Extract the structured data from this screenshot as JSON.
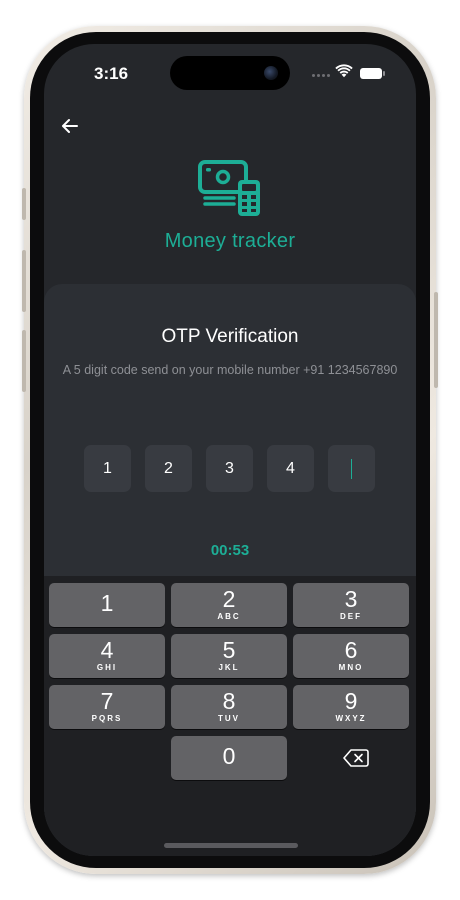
{
  "status_bar": {
    "time": "3:16"
  },
  "header": {
    "back_icon": "arrow-left-icon",
    "logo_icon": "money-calculator-icon",
    "app_name": "Money tracker"
  },
  "otp": {
    "title": "OTP Verification",
    "subtitle": "A 5 digit code send on your mobile number +91 1234567890",
    "digits": [
      "1",
      "2",
      "3",
      "4",
      ""
    ],
    "timer": "00:53"
  },
  "keypad": {
    "keys": [
      {
        "digit": "1",
        "letters": ""
      },
      {
        "digit": "2",
        "letters": "ABC"
      },
      {
        "digit": "3",
        "letters": "DEF"
      },
      {
        "digit": "4",
        "letters": "GHI"
      },
      {
        "digit": "5",
        "letters": "JKL"
      },
      {
        "digit": "6",
        "letters": "MNO"
      },
      {
        "digit": "7",
        "letters": "PQRS"
      },
      {
        "digit": "8",
        "letters": "TUV"
      },
      {
        "digit": "9",
        "letters": "WXYZ"
      },
      {
        "digit": "0",
        "letters": ""
      }
    ],
    "delete_icon": "backspace-icon"
  },
  "colors": {
    "accent": "#1dae96",
    "background": "#25272b",
    "card": "#2c2f34",
    "otp_box": "#383b41",
    "key": "#636366",
    "keypad_bg": "#1f2023"
  }
}
